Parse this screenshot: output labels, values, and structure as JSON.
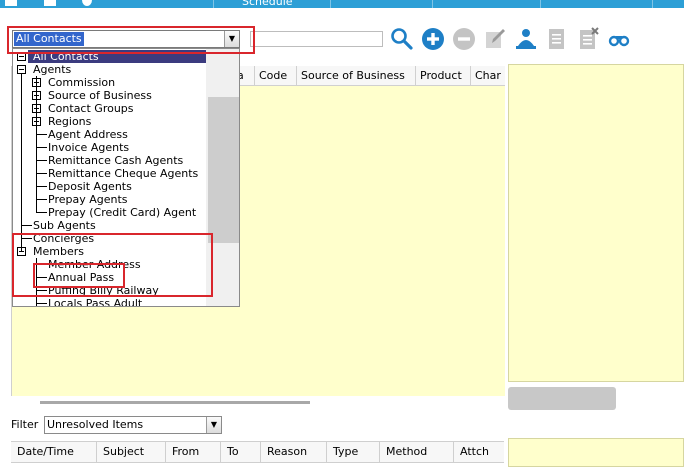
{
  "top_bar": {
    "tab_label": "Schedule",
    "accent_color": "#2d9fd6"
  },
  "contact_combo": {
    "value": "All Contacts"
  },
  "search": {
    "placeholder": ""
  },
  "toolbar": {
    "icons": [
      "search-icon",
      "add-icon",
      "remove-icon",
      "edit-icon",
      "users-icon",
      "document-icon",
      "document-delete-icon",
      "binoculars-icon"
    ]
  },
  "grid": {
    "columns": [
      "ia",
      "Code",
      "Source of Business",
      "Product",
      "Char"
    ]
  },
  "tree": {
    "items": [
      {
        "label": "All Contacts",
        "level": 0,
        "expander": "minus"
      },
      {
        "label": "Agents",
        "level": 0,
        "expander": "minus"
      },
      {
        "label": "Commission",
        "level": 1,
        "expander": "plus"
      },
      {
        "label": "Source of Business",
        "level": 1,
        "expander": "plus"
      },
      {
        "label": "Contact Groups",
        "level": 1,
        "expander": "plus"
      },
      {
        "label": "Regions",
        "level": 1,
        "expander": "plus"
      },
      {
        "label": "Agent Address",
        "level": 1,
        "expander": ""
      },
      {
        "label": "Invoice Agents",
        "level": 1,
        "expander": ""
      },
      {
        "label": "Remittance Cash Agents",
        "level": 1,
        "expander": ""
      },
      {
        "label": "Remittance Cheque Agents",
        "level": 1,
        "expander": ""
      },
      {
        "label": "Deposit Agents",
        "level": 1,
        "expander": ""
      },
      {
        "label": "Prepay Agents",
        "level": 1,
        "expander": ""
      },
      {
        "label": "Prepay (Credit Card) Agent",
        "level": 1,
        "expander": ""
      },
      {
        "label": "Sub Agents",
        "level": 0,
        "expander": ""
      },
      {
        "label": "Concierges",
        "level": 0,
        "expander": ""
      },
      {
        "label": "Members",
        "level": 0,
        "expander": "minus"
      },
      {
        "label": "Member Address",
        "level": 1,
        "expander": ""
      },
      {
        "label": "Annual Pass",
        "level": 1,
        "expander": ""
      },
      {
        "label": "Puffing Billy Railway",
        "level": 1,
        "expander": ""
      },
      {
        "label": "Locals Pass Adult",
        "level": 1,
        "expander": ""
      }
    ]
  },
  "filter": {
    "label": "Filter",
    "value": "Unresolved Items"
  },
  "bottom_table": {
    "columns": [
      "Date/Time",
      "Subject",
      "From",
      "To",
      "Reason",
      "Type",
      "Method",
      "Attch"
    ]
  },
  "colors": {
    "highlight_red": "#d9262c",
    "panel_yellow": "#ffffcc",
    "selection": "#3b3b7f"
  }
}
